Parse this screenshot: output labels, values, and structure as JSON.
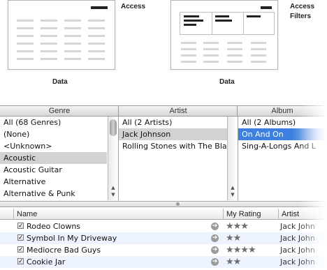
{
  "diagrams": {
    "left": {
      "side_label": "Access",
      "bottom_label": "Data"
    },
    "right": {
      "side_label_1": "Access",
      "side_label_2": "Filters",
      "bottom_label": "Data"
    }
  },
  "browser": {
    "columns": [
      {
        "title": "Genre",
        "items": [
          "All (68 Genres)",
          "(None)",
          "<Unknown>",
          "Acoustic",
          "Acoustic Guitar",
          "Alternative",
          "Alternative & Punk"
        ],
        "selected_index": 3
      },
      {
        "title": "Artist",
        "items": [
          "All (2 Artists)",
          "Jack Johnson",
          "Rolling Stones with The Black"
        ],
        "selected_index": 1
      },
      {
        "title": "Album",
        "items": [
          "All (2 Albums)",
          "On And On",
          "Sing-A-Longs And L"
        ],
        "selected_index": 1
      }
    ]
  },
  "tracklist": {
    "headers": {
      "name": "Name",
      "rating": "My Rating",
      "artist": "Artist"
    },
    "rows": [
      {
        "checked": true,
        "name": "Rodeo Clowns",
        "rating": 3,
        "artist": "Jack John"
      },
      {
        "checked": true,
        "name": "Symbol In My Driveway",
        "rating": 2,
        "artist": "Jack John"
      },
      {
        "checked": true,
        "name": "Mediocre Bad Guys",
        "rating": 4,
        "artist": "Jack John"
      },
      {
        "checked": true,
        "name": "Cookie Jar",
        "rating": 2,
        "artist": "Jack John"
      }
    ]
  },
  "icons": {
    "check": "checkmark-icon",
    "go": "arrow-right-circle-icon",
    "star": "star-icon"
  },
  "colors": {
    "selection_blue": "#3d80df",
    "selection_gray": "#d2d2d2",
    "stripe": "#edf3fe"
  }
}
